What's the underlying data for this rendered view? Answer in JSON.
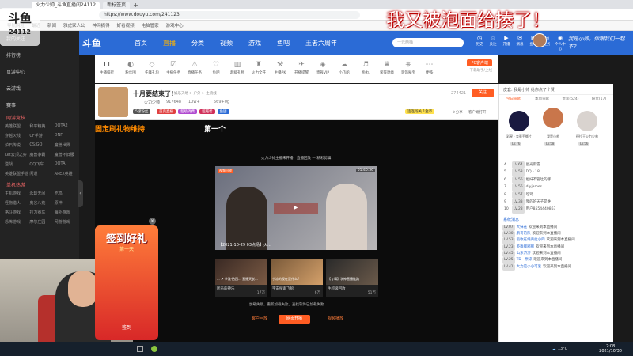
{
  "browser": {
    "tab1": "火力少帅_斗鱼直播间24112",
    "tab2": "新标签页",
    "url": "https://www.douyu.com/241123",
    "bookmarks": [
      "导航网址",
      "最近",
      "新闻",
      "雅虎家人公",
      "神网摘得",
      "好看视频",
      "电脑管家",
      "游戏中心"
    ]
  },
  "overlay": {
    "title_text": "我又被泡面给揍了！",
    "logo_text": "斗鱼",
    "room_id": "24112",
    "watermark": "我是小帅，你跟我们一起不？"
  },
  "header": {
    "logo": "斗鱼",
    "nav": [
      "首页",
      "直播",
      "分类",
      "视频",
      "游戏",
      "鱼吧",
      "王者六周年"
    ],
    "search_placeholder": "一元两桶"
  },
  "header_icons": [
    {
      "glyph": "◷",
      "label": "历史"
    },
    {
      "glyph": "☆",
      "label": "关注"
    },
    {
      "glyph": "▶",
      "label": "开播"
    },
    {
      "glyph": "✉",
      "label": "消息"
    },
    {
      "glyph": "▣",
      "label": "鱼吧"
    },
    {
      "glyph": "◎",
      "label": "任务"
    },
    {
      "glyph": "◉",
      "label": "个人中心"
    }
  ],
  "sidebar": {
    "items": [
      "我的关注",
      "排行榜",
      "页游中心",
      "云游戏",
      "赛事"
    ],
    "sections": [
      {
        "title": "网游竞技",
        "items": [
          "英雄联盟",
          "和平精英",
          "DOTA2",
          "穿越火线",
          "CF手游",
          "DNF",
          "炉石传说",
          "CS:GO",
          "魔兽世界",
          "Let云顶之弈",
          "魔兽争霸",
          "魔兽怀旧服",
          "逆战",
          "QQ飞车",
          "DOTA",
          "英雄联盟手游",
          "问道",
          "APEX英雄"
        ]
      },
      {
        "title": "单机热游",
        "items": [
          "主机游戏",
          "永劫无间",
          "吃鸡",
          "怪物猎人",
          "鬼谷八荒",
          "原神",
          "格斗游戏",
          "拉力赛车",
          "海外游戏",
          "恐怖游戏",
          "摩尔庄园",
          "网游游戏"
        ]
      }
    ]
  },
  "category_bar": {
    "first": {
      "label": "主播排行",
      "sub": "11"
    },
    "items": [
      {
        "glyph": "◐",
        "label": "粉丝团"
      },
      {
        "glyph": "◇",
        "label": "先锋礼包"
      },
      {
        "glyph": "☑",
        "label": "主播任务"
      },
      {
        "glyph": "⚠",
        "label": "直播任务"
      },
      {
        "glyph": "♡",
        "label": "鱼吧"
      },
      {
        "glyph": "▥",
        "label": "超级礼物"
      },
      {
        "glyph": "♜",
        "label": "火力全开"
      },
      {
        "glyph": "⚒",
        "label": "主播PK"
      },
      {
        "glyph": "✈",
        "label": "开播提醒"
      },
      {
        "glyph": "◈",
        "label": "贵族VIP"
      },
      {
        "glyph": "☁",
        "label": "小飞船"
      },
      {
        "glyph": "♬",
        "label": "鱼丸"
      },
      {
        "glyph": "♛",
        "label": "荣誉勋章"
      },
      {
        "glyph": "⎈",
        "label": "装饰秘宝"
      },
      {
        "glyph": "⋯",
        "label": "更多"
      }
    ],
    "pc_button": "PC客户端",
    "pc_sub": "下载助手/上线"
  },
  "room": {
    "title": "十月要结束了!",
    "category": "娱乐天地 > 户外 > 主流线",
    "streamer": "火力少帅",
    "fans": "917648",
    "hot": "10w+",
    "share_count": "569+0g",
    "tags": [
      "首页直播",
      "超级消费",
      "超越者",
      "鱼团"
    ],
    "tag_badge": "5级粉丝",
    "views": "274421",
    "follow_button": "关注",
    "invite_text": "邀请好友",
    "badge2": "连连闯关 1金币",
    "share_label": "分享",
    "client_label": "客户端打开"
  },
  "player": {
    "left_caption": "固定刷礼物维持",
    "center_caption": "第一个",
    "notice": "火力少帅主播未开播，直播回放 — 精彩剪辑",
    "main_video": {
      "time": "01:40:56",
      "label_chip": "视频回放",
      "caption": "【2021-10-29 03点场】火..."
    },
    "cards": [
      {
        "label": "... > 争流·抬西... 直播天长...",
        "name": "团员的神乐",
        "views": "17万"
      },
      {
        "label": "宁凉的现在是什么?",
        "name": "宇宙探索飞船",
        "views": "6万"
      },
      {
        "label": "【专辑】学神直播连路",
        "name": "牛超级回放",
        "views": "51万"
      }
    ],
    "footer_text": "加载失败，重新加载失败，查找软件已加载失败",
    "buttons": [
      "客户回放",
      "网页开播",
      "视频播放"
    ]
  },
  "chat": {
    "header": "皮套: 我是小帅 给你点了个赞",
    "tabs": [
      "今日贡献",
      "本周贡献",
      "贵宾(524)",
      "粉丝(17)"
    ],
    "podium": [
      {
        "name": "彩星 · 卖蛋手撕片",
        "lv": "LV.76"
      },
      {
        "name": "我是小帅",
        "lv": "LV.58"
      },
      {
        "name": "德拉王火力少帅",
        "lv": "LV.56"
      }
    ],
    "rank": [
      {
        "n": "4",
        "lv": "LV.64",
        "name": "星光雨雪"
      },
      {
        "n": "5",
        "lv": "LV.53",
        "name": "DQ - 18"
      },
      {
        "n": "6",
        "lv": "LV.56",
        "name": "姐妹不管吐的哪"
      },
      {
        "n": "7",
        "lv": "LV.56",
        "name": "diyjames"
      },
      {
        "n": "8",
        "lv": "LV.57",
        "name": "吃鸡"
      },
      {
        "n": "9",
        "lv": "LV.33",
        "name": "我的的天子是谁"
      },
      {
        "n": "10",
        "lv": "LV.28",
        "name": "用户8554440863"
      }
    ],
    "section": "系统消息",
    "messages": [
      {
        "lv": "LV.07",
        "user": "大抹花",
        "text": "欢迎来到本直播间"
      },
      {
        "lv": "LV.30",
        "user": "鹏哥的队",
        "text": "欢迎来到本直播间"
      },
      {
        "lv": "LV.53",
        "user": "吸收在线再拉小四",
        "text": "欢迎来到本直播间"
      },
      {
        "lv": "LV.23",
        "user": "英雄嘟嘟嘟",
        "text": "欢迎来到本直播间"
      },
      {
        "lv": "LV.45",
        "user": "山东济济",
        "text": "欢迎来到本直播间"
      },
      {
        "lv": "LV.25",
        "user": "TD - 原谅",
        "text": "欢迎来到本直播间"
      },
      {
        "lv": "LV.41",
        "user": "大力是小小可爱",
        "text": "欢迎来到本直播间"
      }
    ]
  },
  "gift_overlay": {
    "title": "签到好礼",
    "sub": "第一天",
    "badge": "签到"
  },
  "taskbar": {
    "weather": "13°C",
    "time": "2:08",
    "date": "2021/10/30"
  }
}
